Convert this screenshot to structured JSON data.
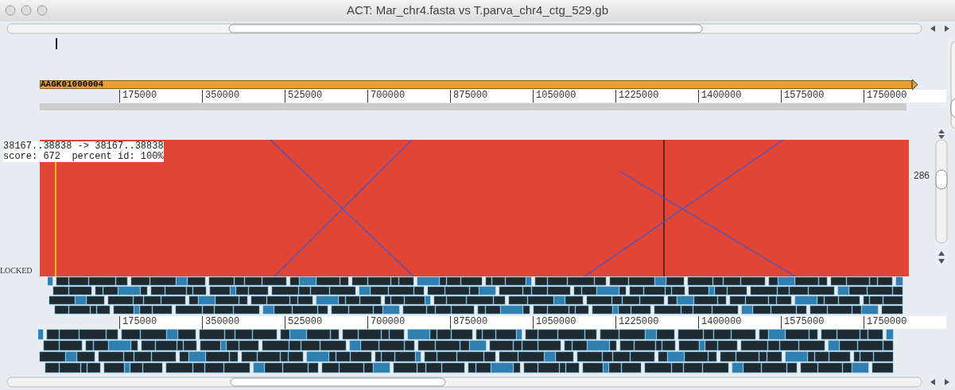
{
  "window": {
    "title": "ACT: Mar_chr4.fasta vs T.parva_chr4_ctg_529.gb"
  },
  "top_entry": {
    "contig_label": "AAGK01000004",
    "ruler_ticks": [
      "175000",
      "350000",
      "525000",
      "700000",
      "875000",
      "1050000",
      "1225000",
      "1400000",
      "1575000",
      "1750000"
    ]
  },
  "comparison": {
    "match_info": [
      "38167..38838 -> 38167..38838",
      "score: 672  percent id: 100%"
    ],
    "locked_label": "LOCKED",
    "scale_value": "286"
  },
  "bottom_entry": {
    "ruler_ticks": [
      "175000",
      "350000",
      "525000",
      "700000",
      "875000",
      "1050000",
      "1225000",
      "1400000",
      "1575000",
      "1750000"
    ]
  }
}
